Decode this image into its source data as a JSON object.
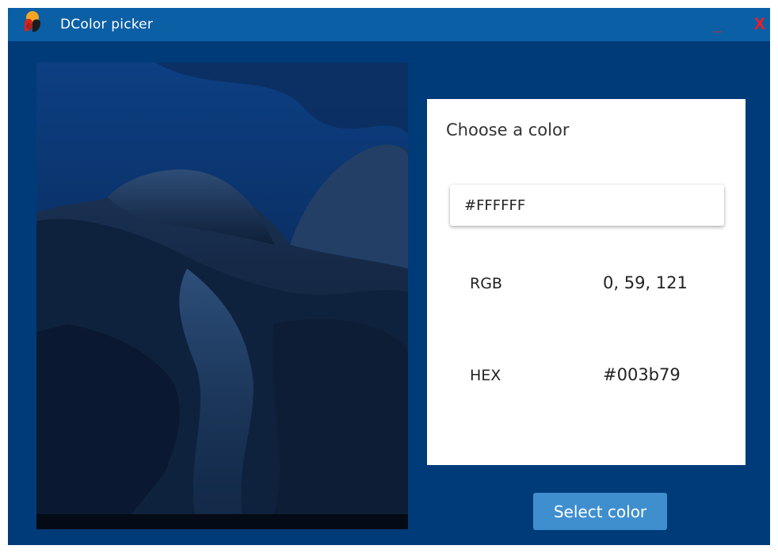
{
  "window": {
    "title": "DColor picker",
    "minimize_label": "_",
    "close_label": "X"
  },
  "picker": {
    "title": "Choose a color",
    "input_value": "#FFFFFF",
    "rgb_label": "RGB",
    "rgb_value": "0, 59, 121",
    "hex_label": "HEX",
    "hex_value": "#003b79"
  },
  "actions": {
    "select_label": "Select color"
  },
  "colors": {
    "window_background": "#003b79",
    "titlebar": "#0b5fa5",
    "button": "#3f8fcf",
    "close_icon": "#ff1a1a"
  },
  "icons": {
    "app": "app-logo-icon",
    "minimize": "minimize-icon",
    "close": "close-icon"
  }
}
